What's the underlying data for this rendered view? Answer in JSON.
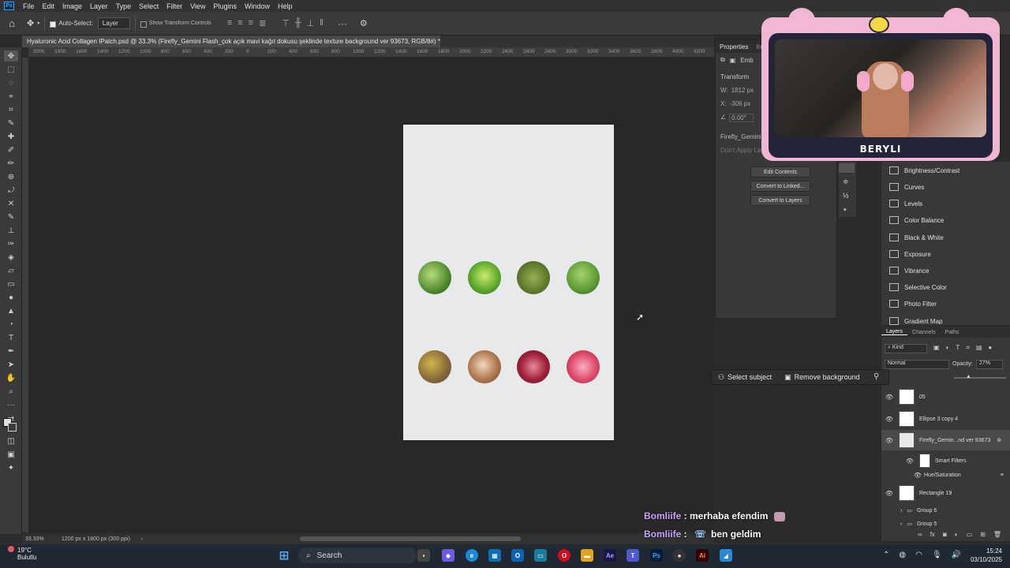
{
  "menu": {
    "logo": "Ps",
    "items": [
      "File",
      "Edit",
      "Image",
      "Layer",
      "Type",
      "Select",
      "Filter",
      "View",
      "Plugins",
      "Window",
      "Help"
    ]
  },
  "options": {
    "auto_select_label": "Auto-Select:",
    "auto_select_value": "Layer",
    "show_transform_label": "Show Transform Controls"
  },
  "document": {
    "tab_title": "Hyaluronic Acid Collagen IPatch.psd @ 33.3% (Firefly_Gemini Flash_çok açık mavi kağıt dokusu şeklinde texture background ver 93673, RGB/8#) *",
    "zoom": "33.33%",
    "size_info": "1200 px x 1800 px (300 ppi)"
  },
  "ruler_ticks": [
    "2000",
    "1800",
    "1600",
    "1400",
    "1200",
    "1000",
    "800",
    "600",
    "400",
    "200",
    "0",
    "200",
    "400",
    "600",
    "800",
    "1000",
    "1200",
    "1400",
    "1600",
    "1800",
    "2000",
    "2200",
    "2400",
    "2600",
    "2800",
    "3000",
    "3200",
    "3400",
    "3600",
    "3800",
    "4000",
    "4200"
  ],
  "properties": {
    "tabs": [
      "Properties",
      "Ini"
    ],
    "embed_label": "Emb",
    "transform_heading": "Transform",
    "w_label": "W:",
    "w_value": "1812 px",
    "x_label": "X:",
    "x_value": "-306 px",
    "angle_value": "0.00°",
    "layer_name": "Firefly_Gemini Flas",
    "dont_apply": "Don't Apply Layer",
    "buttons": [
      "Edit Contents",
      "Convert to Linked...",
      "Convert to Layers"
    ]
  },
  "adjustments": [
    "Brightness/Contrast",
    "Curves",
    "Levels",
    "Color Balance",
    "Black & White",
    "Exposure",
    "Vibrance",
    "Selective Color",
    "Photo Filter",
    "Gradient Map"
  ],
  "layers_panel": {
    "tabs": [
      "Layers",
      "Channels",
      "Paths"
    ],
    "kind_label": "Kind",
    "blend_mode": "Normal",
    "opacity_label": "Opacity:",
    "opacity_value": "27%",
    "rows": [
      "05",
      "Ellipse 3 copy 4",
      "Firefly_Gemin...nd ver 93673",
      "Smart Filters",
      "Hue/Saturation",
      "Rectangle 19",
      "Group 6",
      "Group 5"
    ]
  },
  "context_bar": {
    "select_subject": "Select subject",
    "remove_background": "Remove background"
  },
  "stream": {
    "streamer_name": "BERYLI",
    "chat": [
      {
        "user": "Bomliife",
        "sep": " : ",
        "message": "merhaba efendim"
      },
      {
        "user": "Bomliife",
        "sep": " : ",
        "message": "ben geldim"
      }
    ]
  },
  "taskbar": {
    "temperature": "19°C",
    "weather": "Bulutlu",
    "search_label": "Search",
    "time": "15:24",
    "date": "03/10/2025"
  },
  "colors": {
    "accent": "#31a8ff",
    "chat_user": "#c9a6ff",
    "overlay_pink": "#f1b7d2"
  }
}
